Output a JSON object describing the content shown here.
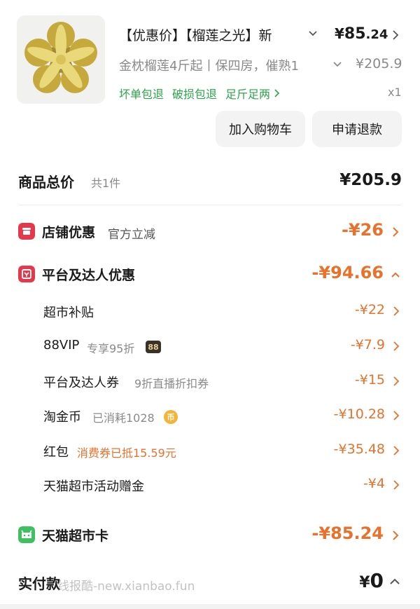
{
  "product": {
    "title": "【优惠价】【榴莲之光】新",
    "price_currency": "¥",
    "price_int": "85",
    "price_dec": ".24",
    "spec": "金枕榴莲4斤起丨保四房，催熟1",
    "original_price": "¥205.9",
    "guarantees": [
      "坏单包退",
      "破损包退",
      "足斤足两"
    ],
    "quantity": "x1",
    "add_to_cart_label": "加入购物车",
    "refund_label": "申请退款",
    "image_icon": "durian-photo"
  },
  "summary": {
    "label": "商品总价",
    "count": "共1件",
    "amount": "¥205.9"
  },
  "discounts": {
    "store": {
      "label": "店铺优惠",
      "sub": "官方立减",
      "amount": "-¥26",
      "icon": "store-icon",
      "icon_color": "#e5394b"
    },
    "platform": {
      "label": "平台及达人优惠",
      "amount": "-¥94.66",
      "icon": "coupon-icon",
      "icon_color": "#e5394b",
      "expanded": true,
      "items": [
        {
          "label": "超市补贴",
          "sub": "",
          "amount": "-¥22"
        },
        {
          "label": "88VIP",
          "sub": "专享95折",
          "badge": "88",
          "amount": "-¥7.9"
        },
        {
          "label": "平台及达人券",
          "sub": "9折直播折扣券",
          "amount": "-¥15"
        },
        {
          "label": "淘金币",
          "sub": "已消耗1028",
          "coin": "币",
          "amount": "-¥10.28"
        },
        {
          "label": "红包",
          "sub": "消费券已抵15.59元",
          "amount": "-¥35.48"
        },
        {
          "label": "天猫超市活动赠金",
          "sub": "",
          "amount": "-¥4"
        }
      ]
    },
    "card": {
      "label": "天猫超市卡",
      "amount": "-¥85.24",
      "icon": "tmall-card-icon",
      "icon_color": "#3ec060"
    }
  },
  "final": {
    "label": "实付款",
    "currency": "¥",
    "amount": "0"
  },
  "watermark": "线报酷-new.xianbao.fun",
  "colors": {
    "accent_orange": "#e8712c",
    "guarantee_green": "#2aa54a",
    "muted_gray": "#8a8a8a"
  }
}
